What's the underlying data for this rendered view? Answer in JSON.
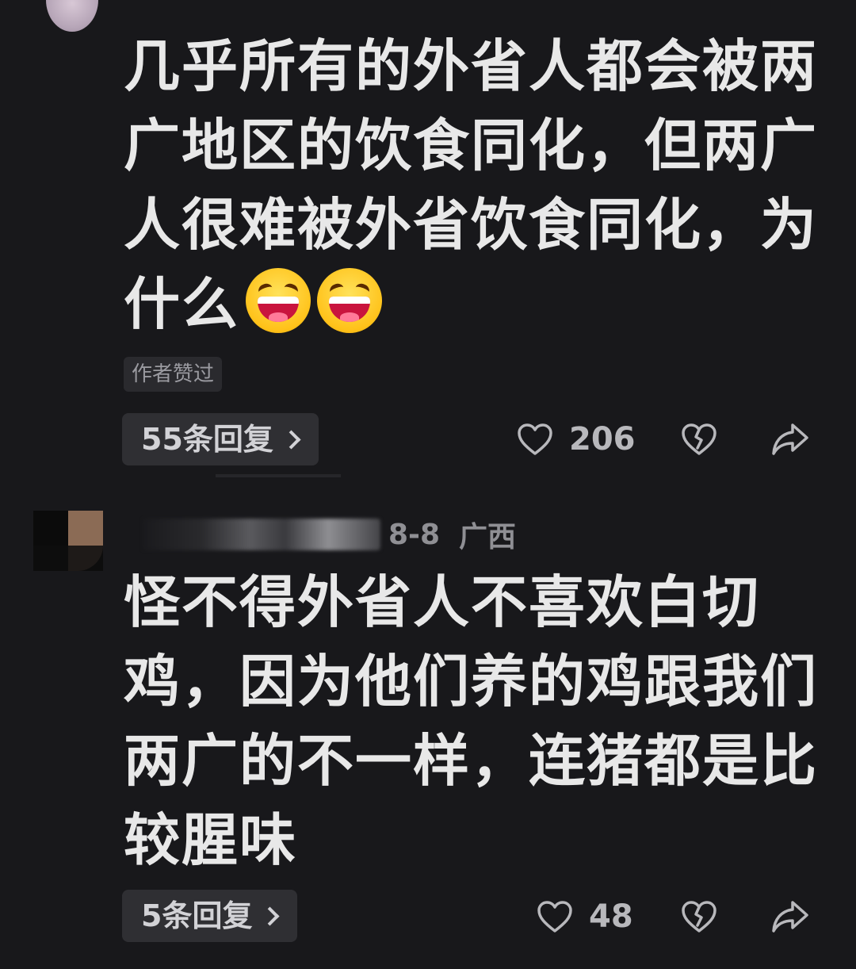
{
  "comment1": {
    "text_lines": [
      "几乎所有的外省人都会被两",
      "广地区的饮食同化，但两广",
      "人很难被外省饮食同化，为",
      "什么"
    ],
    "emojis": [
      "laughing-squint-emoji",
      "laughing-squint-emoji"
    ],
    "author_liked_badge": "作者赞过",
    "replies_label": "55条回复",
    "like_count": "206"
  },
  "comment2": {
    "date": "8-8",
    "location": "广西",
    "text_lines": [
      "怪不得外省人不喜欢白切",
      "鸡，因为他们养的鸡跟我们",
      "两广的不一样，连猪都是比",
      "较腥味"
    ],
    "replies_label": "5条回复",
    "like_count": "48"
  },
  "icons": {
    "like": "heart-outline-icon",
    "dislike": "broken-heart-icon",
    "share": "share-arrow-icon"
  },
  "colors": {
    "background": "#18181b",
    "text": "#e8e8e8",
    "muted": "#8f8f94",
    "button_bg": "#2f2f33"
  }
}
